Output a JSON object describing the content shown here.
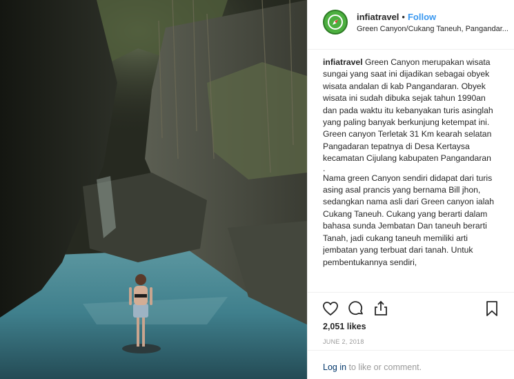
{
  "post": {
    "username": "infiatravel",
    "separator": "•",
    "follow_label": "Follow",
    "location": "Green Canyon/Cukang Taneuh, Pangandar...",
    "caption": {
      "username": "infiatravel",
      "paragraph1": "Green Canyon merupakan wisata sungai yang saat ini dijadikan sebagai obyek wisata andalan di kab Pangandaran. Obyek wisata ini sudah dibuka sejak tahun 1990an dan pada waktu itu kebanyakan turis asinglah yang paling banyak berkunjung ketempat ini. Green canyon Terletak 31 Km kearah selatan Pangadaran tepatnya di Desa Kertaysa kecamatan Cijulang kabupaten Pangandaran",
      "divider": ".",
      "paragraph2": "Nama green Canyon sendiri didapat dari turis asing asal prancis yang bernama Bill jhon, sedangkan nama asli dari Green canyon ialah Cukang Taneuh. Cukang yang berarti dalam bahasa sunda Jembatan Dan taneuh berarti Tanah, jadi cukang taneuh memiliki arti jembatan yang terbuat dari tanah. Untuk pembentukannya sendiri,"
    },
    "likes": "2,051 likes",
    "date": "JUNE 2, 2018",
    "comment": {
      "login_label": "Log in",
      "suffix": " to like or comment."
    }
  },
  "icons": {
    "avatar": "compass-icon",
    "like": "heart-icon",
    "comment": "comment-bubble-icon",
    "share": "share-icon",
    "save": "bookmark-icon"
  },
  "colors": {
    "follow": "#3897f0",
    "avatar_bg": "#4caf3f",
    "link": "#003569",
    "water": "#3f7f8c"
  }
}
